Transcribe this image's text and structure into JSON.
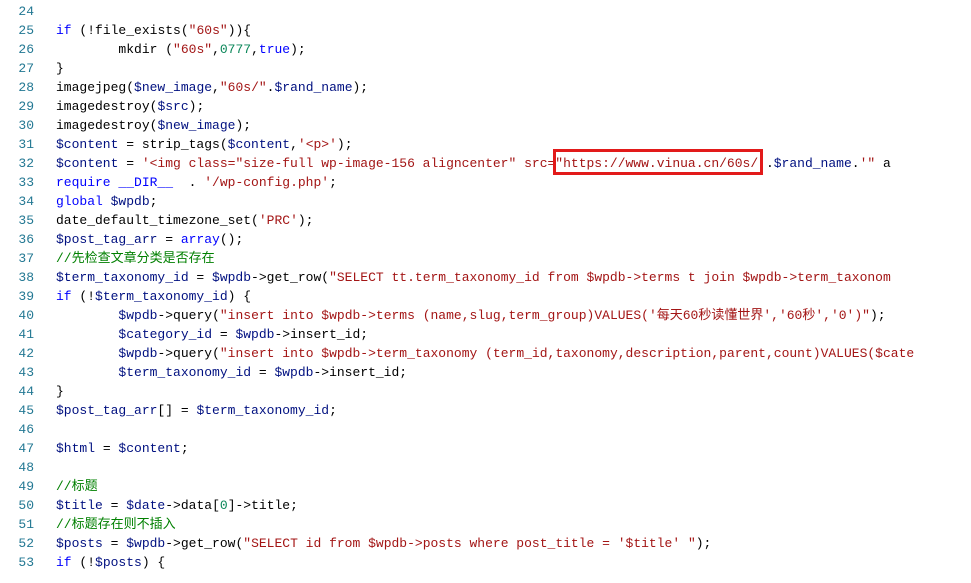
{
  "lines": {
    "24": {
      "n": "24",
      "text": "",
      "visible_fragment_class": "cmnt"
    },
    "25": {
      "n": "25",
      "kw_if": "if",
      "op1": "(!",
      "fn": "file_exists",
      "op2": "(",
      "str": "\"60s\"",
      "op3": ")){"
    },
    "26": {
      "n": "26",
      "indent": "        ",
      "fn": "mkdir",
      "op1": " (",
      "str1": "\"60s\"",
      "op2": ",",
      "num": "0777",
      "op3": ",",
      "true": "true",
      "op4": ");"
    },
    "27": {
      "n": "27",
      "text": "}"
    },
    "28": {
      "n": "28",
      "fn": "imagejpeg",
      "op1": "(",
      "v1": "$new_image",
      "op2": ",",
      "str": "\"60s/\"",
      "op3": ".",
      "v2": "$rand_name",
      "op4": ");"
    },
    "29": {
      "n": "29",
      "fn": "imagedestroy",
      "op1": "(",
      "v1": "$src",
      "op2": ");"
    },
    "30": {
      "n": "30",
      "fn": "imagedestroy",
      "op1": "(",
      "v1": "$new_image",
      "op2": ");"
    },
    "31": {
      "n": "31",
      "v1": "$content",
      "op1": " = ",
      "fn": "strip_tags",
      "op2": "(",
      "v2": "$content",
      "op3": ",",
      "str": "'<p>'",
      "op4": ");"
    },
    "32": {
      "n": "32",
      "v1": "$content",
      "op1": " = ",
      "str1": "'<img class=\"size-full wp-image-156 aligncenter\" src=",
      "str_hl": "\"https://www.vinua.cn/60s/'",
      "op2": ".",
      "v2": "$rand_name",
      "op3": ".",
      "str2": "'\"",
      "trail": " a"
    },
    "33": {
      "n": "33",
      "kw": "require",
      "op1": " ",
      "const": "__DIR__",
      "op2": "  . ",
      "str": "'/wp-config.php'",
      "op3": ";"
    },
    "34": {
      "n": "34",
      "kw": "global",
      "op1": " ",
      "v1": "$wpdb",
      "op2": ";"
    },
    "35": {
      "n": "35",
      "fn": "date_default_timezone_set",
      "op1": "(",
      "str": "'PRC'",
      "op2": ");"
    },
    "36": {
      "n": "36",
      "v1": "$post_tag_arr",
      "op1": " = ",
      "fn": "array",
      "op2": "();"
    },
    "37": {
      "n": "37",
      "text": "//先检查文章分类是否存在"
    },
    "38": {
      "n": "38",
      "v1": "$term_taxonomy_id",
      "op1": " = ",
      "v2": "$wpdb",
      "op2": "->",
      "fn": "get_row",
      "op3": "(",
      "str": "\"SELECT tt.term_taxonomy_id from $wpdb->terms t join $wpdb->term_taxonom"
    },
    "39": {
      "n": "39",
      "kw_if": "if",
      "op1": " (!",
      "v1": "$term_taxonomy_id",
      "op2": ") {"
    },
    "40": {
      "n": "40",
      "indent": "        ",
      "v1": "$wpdb",
      "op1": "->",
      "fn": "query",
      "op2": "(",
      "str": "\"insert into $wpdb->terms (name,slug,term_group)VALUES('每天60秒读懂世界','60秒','0')\"",
      "op3": ");"
    },
    "41": {
      "n": "41",
      "indent": "        ",
      "v1": "$category_id",
      "op1": " = ",
      "v2": "$wpdb",
      "op2": "->",
      "fn": "insert_id",
      "op3": ";"
    },
    "42": {
      "n": "42",
      "indent": "        ",
      "v1": "$wpdb",
      "op1": "->",
      "fn": "query",
      "op2": "(",
      "str": "\"insert into $wpdb->term_taxonomy (term_id,taxonomy,description,parent,count)VALUES($cate"
    },
    "43": {
      "n": "43",
      "indent": "        ",
      "v1": "$term_taxonomy_id",
      "op1": " = ",
      "v2": "$wpdb",
      "op2": "->",
      "fn": "insert_id",
      "op3": ";"
    },
    "44": {
      "n": "44",
      "text": "}"
    },
    "45": {
      "n": "45",
      "v1": "$post_tag_arr",
      "op1": "[] = ",
      "v2": "$term_taxonomy_id",
      "op2": ";"
    },
    "46": {
      "n": "46"
    },
    "47": {
      "n": "47",
      "v1": "$html",
      "op1": " = ",
      "v2": "$content",
      "op2": ";"
    },
    "48": {
      "n": "48"
    },
    "49": {
      "n": "49",
      "text": "//标题"
    },
    "50": {
      "n": "50",
      "v1": "$title",
      "op1": " = ",
      "v2": "$date",
      "op2": "->",
      "fn1": "data",
      "op3": "[",
      "num": "0",
      "op4": "]->",
      "fn2": "title",
      "op5": ";"
    },
    "51": {
      "n": "51",
      "text": "//标题存在则不插入"
    },
    "52": {
      "n": "52",
      "v1": "$posts",
      "op1": " = ",
      "v2": "$wpdb",
      "op2": "->",
      "fn": "get_row",
      "op3": "(",
      "str": "\"SELECT id from $wpdb->posts where post_title = '$title' \"",
      "op4": ");"
    },
    "53": {
      "n": "53",
      "kw_if": "if",
      "op1": " (!",
      "v1": "$posts",
      "op2": ") {"
    }
  },
  "highlight": {
    "url": "https://www.vinua.cn/60s/"
  }
}
